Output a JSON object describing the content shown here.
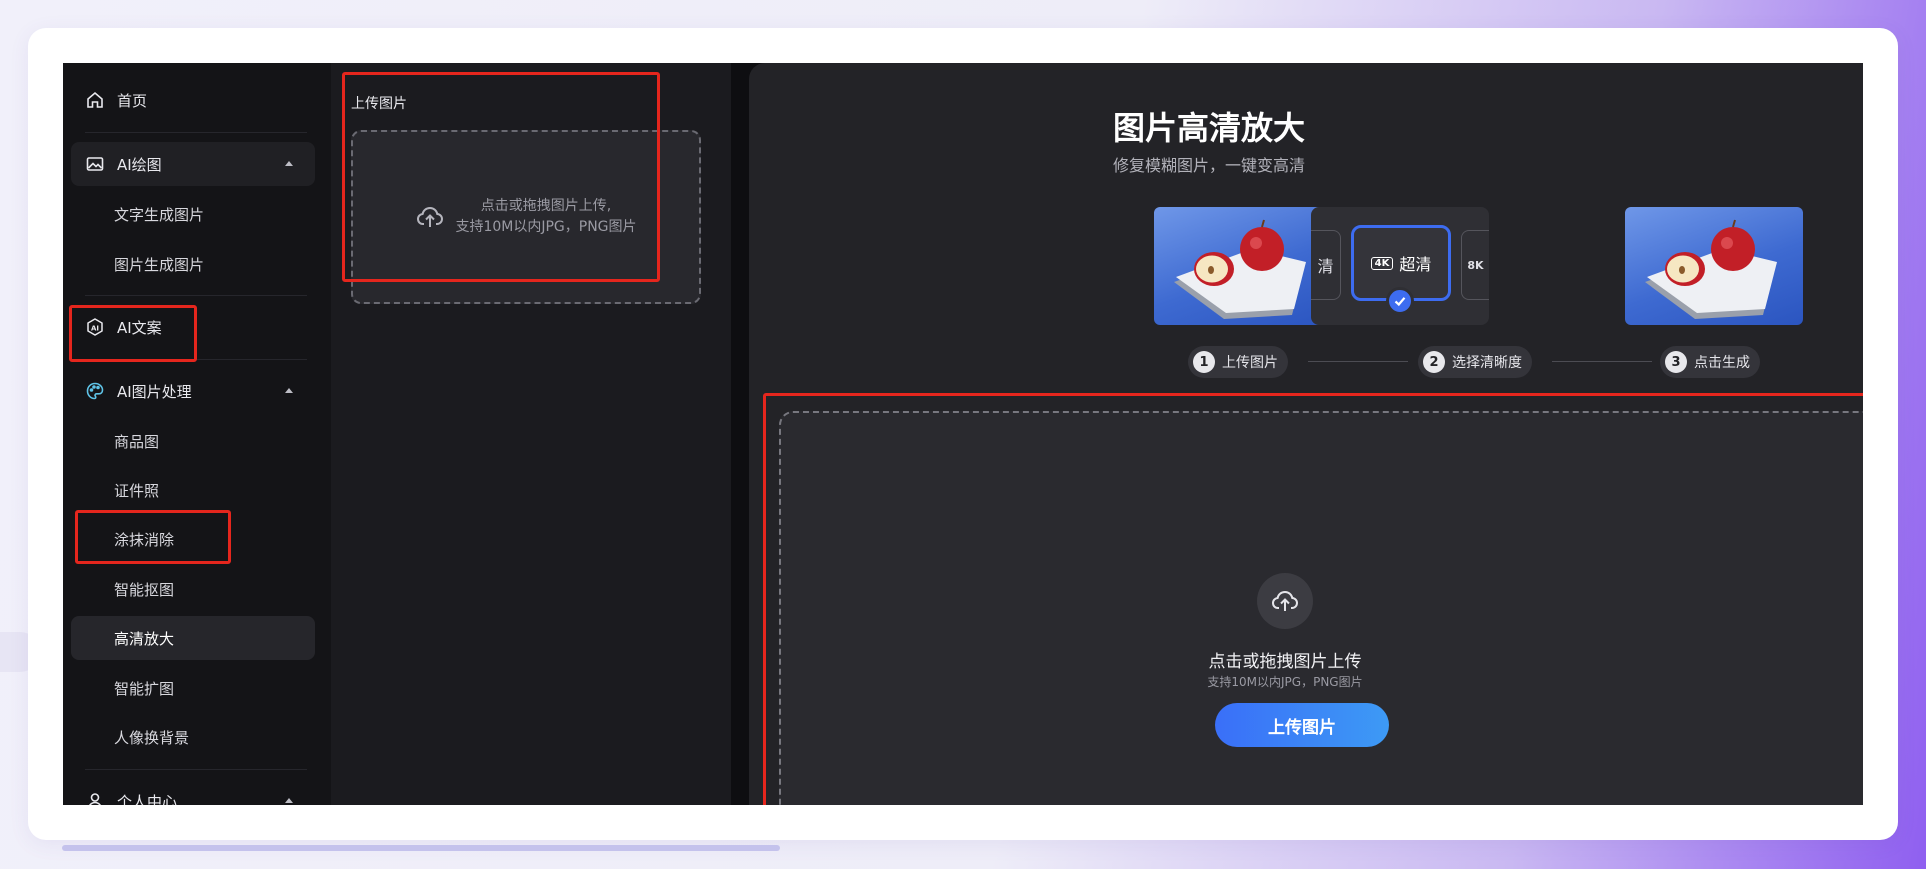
{
  "sidebar": {
    "home": "首页",
    "ai_drawing": {
      "label": "AI绘图",
      "items": [
        "文字生成图片",
        "图片生成图片"
      ]
    },
    "ai_copy": "AI文案",
    "ai_image": {
      "label": "AI图片处理",
      "items": [
        "商品图",
        "证件照",
        "涂抹消除",
        "智能抠图",
        "高清放大",
        "智能扩图",
        "人像换背景"
      ]
    },
    "personal": "个人中心",
    "active_item": "高清放大"
  },
  "panel": {
    "title": "上传图片",
    "drop_line1": "点击或拖拽图片上传,",
    "drop_line2": "支持10M以内JPG，PNG图片"
  },
  "main": {
    "title": "图片高清放大",
    "subtitle": "修复模糊图片，一键变高清",
    "quality_left": "清",
    "quality_selected_badge": "4K",
    "quality_selected": "超清",
    "quality_right": "8K",
    "steps": [
      {
        "num": "1",
        "label": "上传图片"
      },
      {
        "num": "2",
        "label": "选择清晰度"
      },
      {
        "num": "3",
        "label": "点击生成"
      }
    ],
    "upload_title": "点击或拖拽图片上传",
    "upload_hint": "支持10M以内JPG，PNG图片",
    "upload_button": "上传图片"
  },
  "colors": {
    "accent": "#3d6cf0",
    "annotation": "#e5261d",
    "background": "#232327"
  }
}
